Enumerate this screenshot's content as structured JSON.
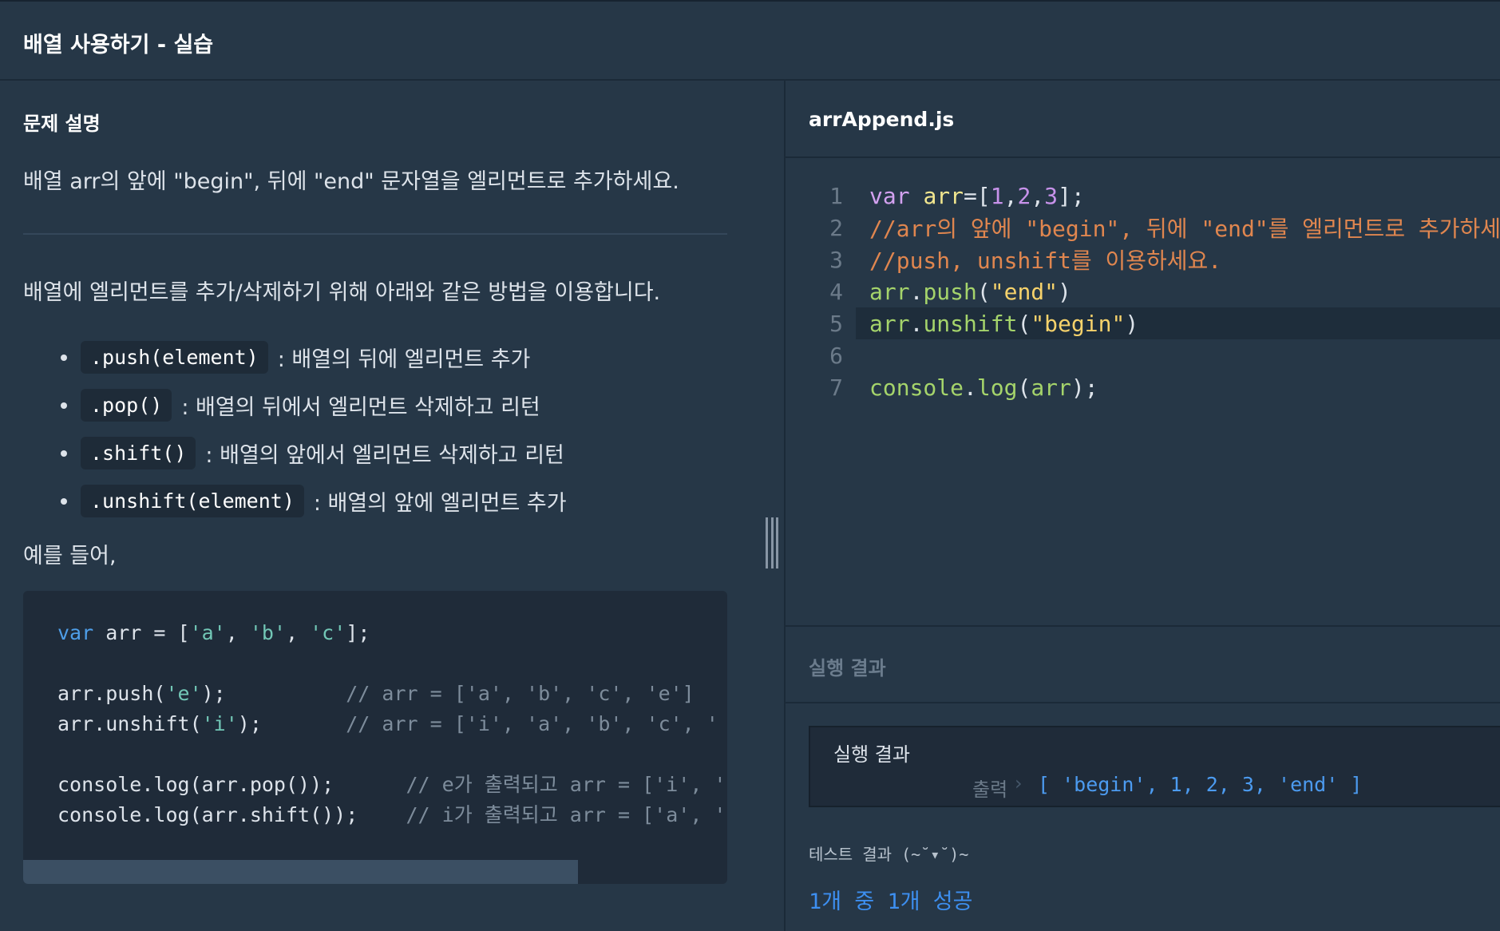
{
  "header": {
    "title": "배열 사용하기 - 실습"
  },
  "problem": {
    "heading": "문제 설명",
    "description": "배열 arr의 앞에 \"begin\", 뒤에 \"end\" 문자열을 엘리먼트로 추가하세요.",
    "intro": "배열에 엘리먼트를 추가/삭제하기 위해 아래와 같은 방법을 이용합니다.",
    "methods": [
      {
        "code": ".push(element)",
        "text": ": 배열의 뒤에 엘리먼트 추가"
      },
      {
        "code": ".pop()",
        "text": ": 배열의 뒤에서 엘리먼트 삭제하고 리턴"
      },
      {
        "code": ".shift()",
        "text": ": 배열의 앞에서 엘리먼트 삭제하고 리턴"
      },
      {
        "code": ".unshift(element)",
        "text": ": 배열의 앞에 엘리먼트 추가"
      }
    ],
    "example_label": "예를 들어,",
    "example_code": [
      "var arr = ['a', 'b', 'c'];",
      "",
      "arr.push('e');          // arr = ['a', 'b', 'c', 'e']",
      "arr.unshift('i');       // arr = ['i', 'a', 'b', 'c', '",
      "",
      "console.log(arr.pop());      // e가 출력되고 arr = ['i', '",
      "console.log(arr.shift());    // i가 출력되고 arr = ['a', '"
    ]
  },
  "editor": {
    "filename": "arrAppend.js",
    "lines": [
      {
        "num": "1",
        "code": "var arr=[1,2,3];"
      },
      {
        "num": "2",
        "code": "//arr의 앞에 \"begin\", 뒤에 \"end\"를 엘리먼트로 추가하세"
      },
      {
        "num": "3",
        "code": "//push, unshift를 이용하세요."
      },
      {
        "num": "4",
        "code": "arr.push(\"end\")"
      },
      {
        "num": "5",
        "code": "arr.unshift(\"begin\")"
      },
      {
        "num": "6",
        "code": ""
      },
      {
        "num": "7",
        "code": "console.log(arr);"
      }
    ],
    "active_line": "5"
  },
  "result": {
    "section_label": "실행 결과",
    "box_title": "실행 결과",
    "output_label": "출력",
    "output_value": "[ 'begin', 1, 2, 3, 'end' ]"
  },
  "test": {
    "title": "테스트 결과 (~˘▾˘)~",
    "summary": "1개 중 1개 성공"
  }
}
